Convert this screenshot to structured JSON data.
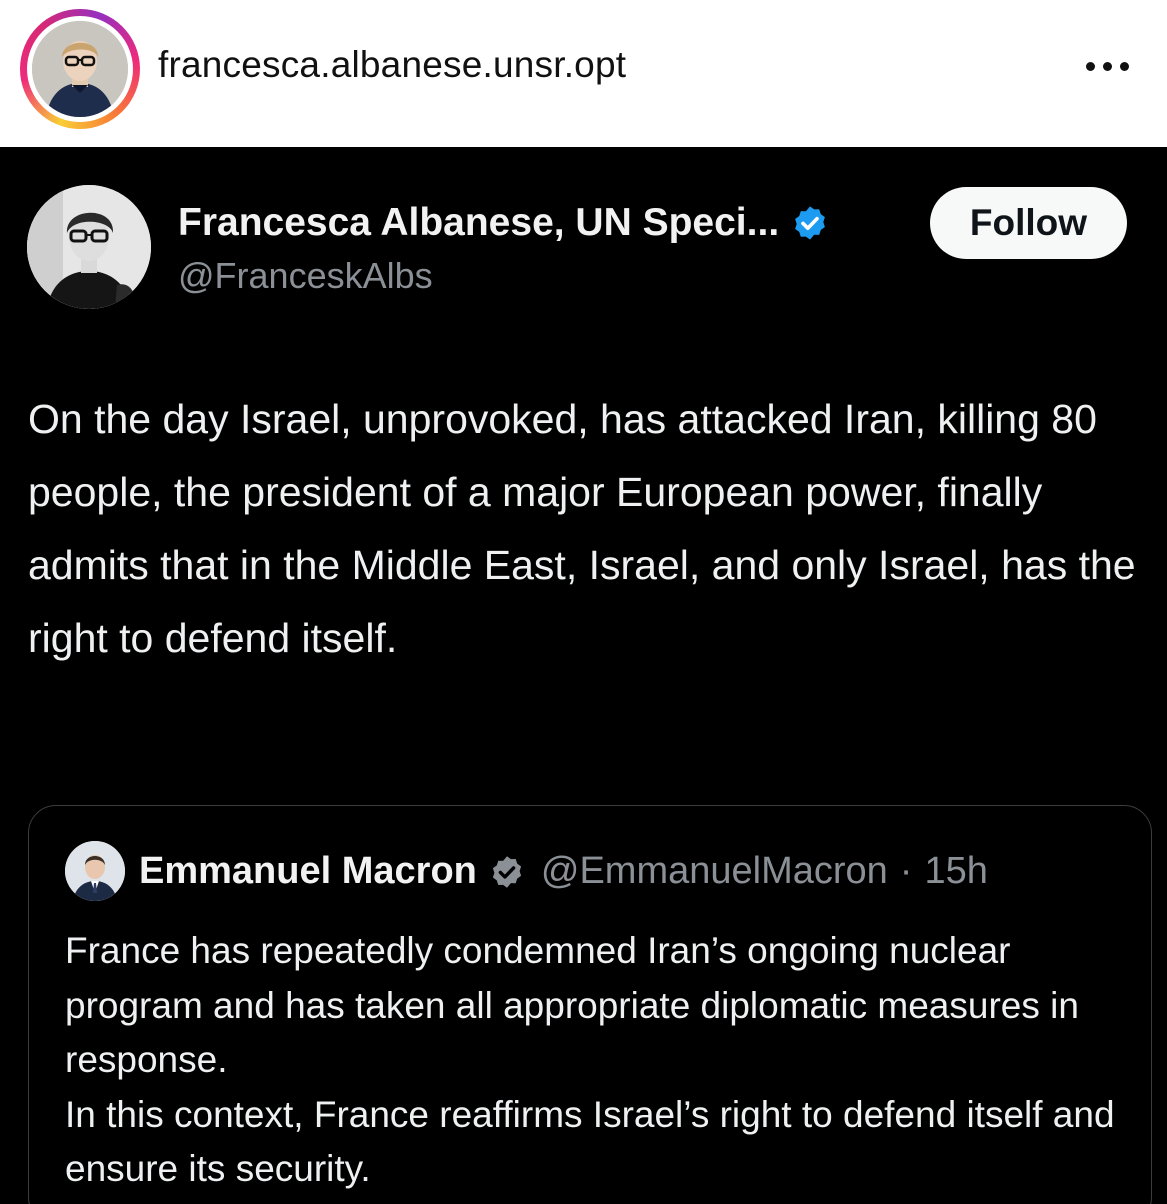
{
  "instagram_header": {
    "username": "francesca.albanese.unsr.opt",
    "more_icon": "more-horizontal-icon"
  },
  "tweet": {
    "author_name": "Francesca Albanese, UN Speci...",
    "author_handle": "@FranceskAlbs",
    "verified_icon": "verified-badge-icon",
    "follow_label": "Follow",
    "text": "On the day Israel, unprovoked, has attacked Iran, killing 80 people, the president of a major European power, finally admits that in the Middle East, Israel, and only Israel, has the right to defend itself."
  },
  "quoted_tweet": {
    "author_name": "Emmanuel Macron",
    "author_handle": "@EmmanuelMacron",
    "separator": "·",
    "time": "15h",
    "verified_icon": "verified-badge-icon",
    "text": "France has repeatedly condemned Iran’s ongoing nuclear program and has taken all appropriate diplomatic measures in response.\nIn this context, France reaffirms Israel’s right to defend itself and ensure its security."
  },
  "colors": {
    "tweet_background": "#000000",
    "verified_blue": "#1d9bf0",
    "quote_badge_gray": "#8b9096",
    "follow_button_bg": "#f7f9f9"
  }
}
